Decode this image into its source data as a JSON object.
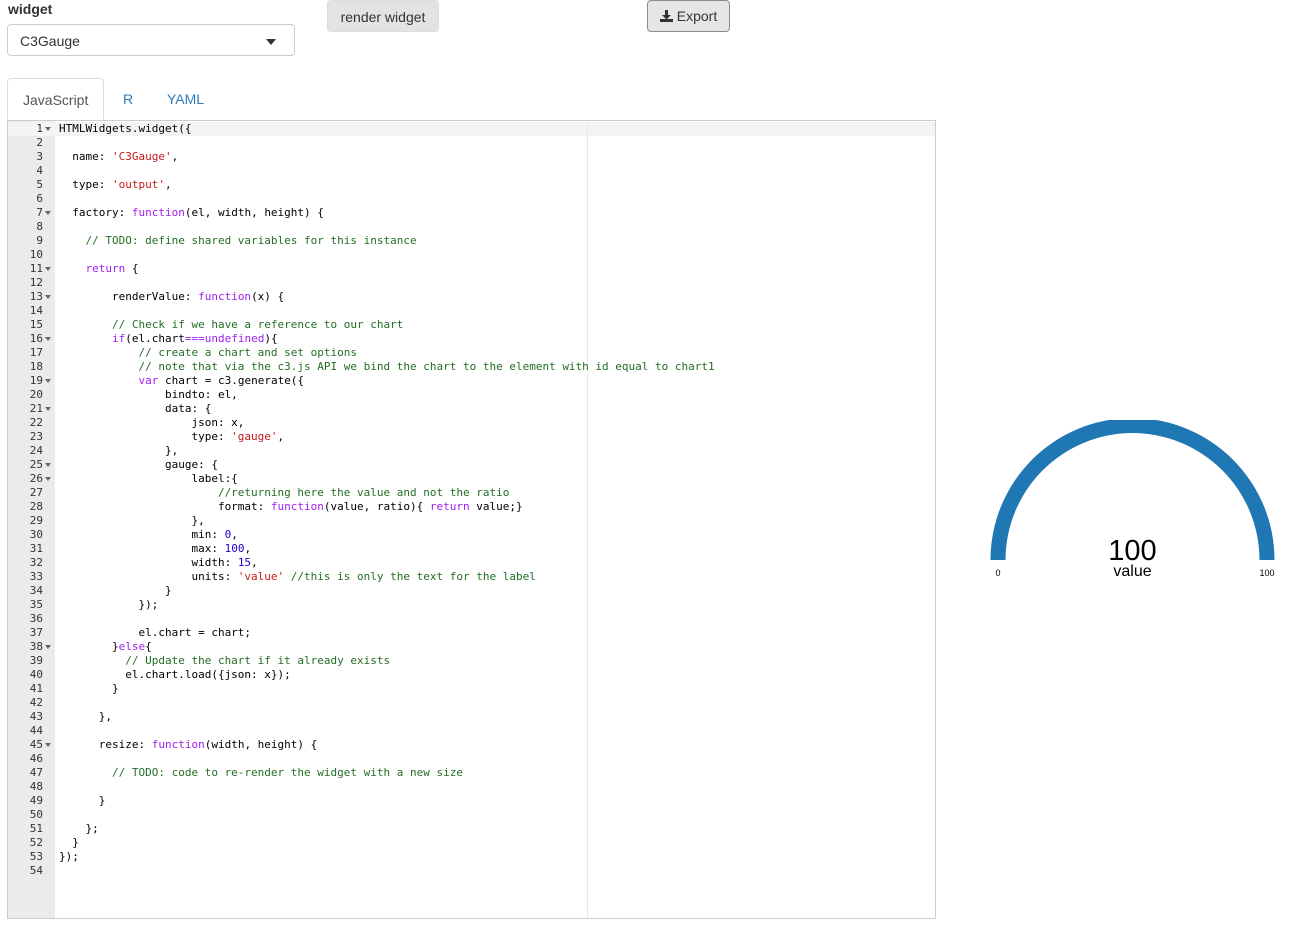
{
  "widget_selector": {
    "label": "widget",
    "selected": "C3Gauge"
  },
  "toolbar": {
    "render_label": "render widget",
    "export_label": "Export"
  },
  "tabs": [
    {
      "label": "JavaScript",
      "active": true
    },
    {
      "label": "R",
      "active": false
    },
    {
      "label": "YAML",
      "active": false
    }
  ],
  "editor": {
    "line_count": 54,
    "fold_lines": [
      1,
      7,
      11,
      13,
      16,
      19,
      21,
      25,
      26,
      38,
      45
    ],
    "code": [
      [
        [
          "t",
          "HTMLWidgets.widget({"
        ]
      ],
      [],
      [
        [
          "t",
          "  name: "
        ],
        [
          "s",
          "'C3Gauge'"
        ],
        [
          "t",
          ","
        ]
      ],
      [],
      [
        [
          "t",
          "  type: "
        ],
        [
          "s",
          "'output'"
        ],
        [
          "t",
          ","
        ]
      ],
      [],
      [
        [
          "t",
          "  factory: "
        ],
        [
          "k",
          "function"
        ],
        [
          "t",
          "(el, width, height) {"
        ]
      ],
      [],
      [
        [
          "c",
          "    // TODO: define shared variables for this instance"
        ]
      ],
      [],
      [
        [
          "t",
          "    "
        ],
        [
          "k",
          "return"
        ],
        [
          "t",
          " {"
        ]
      ],
      [],
      [
        [
          "t",
          "        renderValue: "
        ],
        [
          "k",
          "function"
        ],
        [
          "t",
          "(x) {"
        ]
      ],
      [],
      [
        [
          "c",
          "        // Check if we have a reference to our chart"
        ]
      ],
      [
        [
          "t",
          "        "
        ],
        [
          "k",
          "if"
        ],
        [
          "t",
          "(el.chart"
        ],
        [
          "k",
          "==="
        ],
        [
          "k",
          "undefined"
        ],
        [
          "t",
          "){"
        ]
      ],
      [
        [
          "c",
          "            // create a chart and set options"
        ]
      ],
      [
        [
          "c",
          "            // note that via the c3.js API we bind the chart to the element with id equal to chart1"
        ]
      ],
      [
        [
          "t",
          "            "
        ],
        [
          "k",
          "var"
        ],
        [
          "t",
          " chart = c3.generate({"
        ]
      ],
      [
        [
          "t",
          "                bindto: el,"
        ]
      ],
      [
        [
          "t",
          "                data: {"
        ]
      ],
      [
        [
          "t",
          "                    json: x,"
        ]
      ],
      [
        [
          "t",
          "                    type: "
        ],
        [
          "s",
          "'gauge'"
        ],
        [
          "t",
          ","
        ]
      ],
      [
        [
          "t",
          "                },"
        ]
      ],
      [
        [
          "t",
          "                gauge: {"
        ]
      ],
      [
        [
          "t",
          "                    label:{"
        ]
      ],
      [
        [
          "c",
          "                        //returning here the value and not the ratio"
        ]
      ],
      [
        [
          "t",
          "                        format: "
        ],
        [
          "k",
          "function"
        ],
        [
          "t",
          "(value, ratio){ "
        ],
        [
          "k",
          "return"
        ],
        [
          "t",
          " value;}"
        ]
      ],
      [
        [
          "t",
          "                    },"
        ]
      ],
      [
        [
          "t",
          "                    min: "
        ],
        [
          "n",
          "0"
        ],
        [
          "t",
          ","
        ]
      ],
      [
        [
          "t",
          "                    max: "
        ],
        [
          "n",
          "100"
        ],
        [
          "t",
          ","
        ]
      ],
      [
        [
          "t",
          "                    width: "
        ],
        [
          "n",
          "15"
        ],
        [
          "t",
          ","
        ]
      ],
      [
        [
          "t",
          "                    units: "
        ],
        [
          "s",
          "'value'"
        ],
        [
          "t",
          " "
        ],
        [
          "c",
          "//this is only the text for the label"
        ]
      ],
      [
        [
          "t",
          "                }"
        ]
      ],
      [
        [
          "t",
          "            });"
        ]
      ],
      [],
      [
        [
          "t",
          "            el.chart = chart;"
        ]
      ],
      [
        [
          "t",
          "        }"
        ],
        [
          "k",
          "else"
        ],
        [
          "t",
          "{"
        ]
      ],
      [
        [
          "c",
          "          // Update the chart if it already exists"
        ]
      ],
      [
        [
          "t",
          "          el.chart.load({json: x});"
        ]
      ],
      [
        [
          "t",
          "        }"
        ]
      ],
      [],
      [
        [
          "t",
          "      },"
        ]
      ],
      [],
      [
        [
          "t",
          "      resize: "
        ],
        [
          "k",
          "function"
        ],
        [
          "t",
          "(width, height) {"
        ]
      ],
      [],
      [
        [
          "c",
          "        // TODO: code to re-render the widget with a new size"
        ]
      ],
      [],
      [
        [
          "t",
          "      }"
        ]
      ],
      [],
      [
        [
          "t",
          "    };"
        ]
      ],
      [
        [
          "t",
          "  }"
        ]
      ],
      [
        [
          "t",
          "});"
        ]
      ],
      []
    ]
  },
  "gauge": {
    "value": 100,
    "value_text": "100",
    "units": "value",
    "min": 0,
    "max": 100,
    "min_label": "0",
    "max_label": "100",
    "color": "#1f77b4",
    "background_color": "#e0e0e0"
  }
}
